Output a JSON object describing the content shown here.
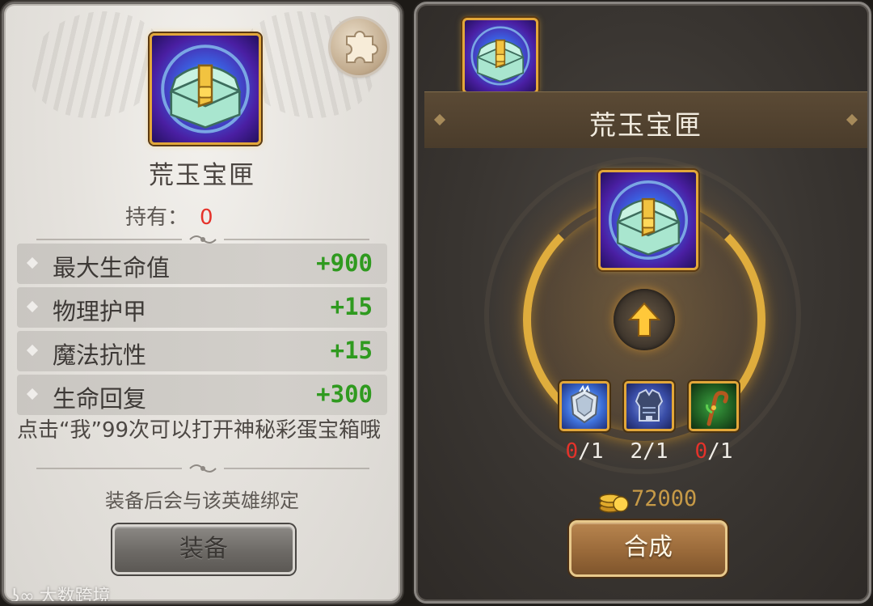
{
  "left_panel": {
    "item_name": "荒玉宝匣",
    "own_label": "持有：",
    "own_count": "0",
    "stats": [
      {
        "label": "最大生命值",
        "value": "+900"
      },
      {
        "label": "物理护甲",
        "value": "+15"
      },
      {
        "label": "魔法抗性",
        "value": "+15"
      },
      {
        "label": "生命回复",
        "value": "+300"
      }
    ],
    "description": "点击“我”99次可以打开神秘彩蛋宝箱哦",
    "bind_note": "装备后会与该英雄绑定",
    "equip_label": "装备"
  },
  "right_panel": {
    "title": "荒玉宝匣",
    "materials": [
      {
        "icon": "crystal-shield-icon",
        "have": "0",
        "need": "1"
      },
      {
        "icon": "armor-vest-icon",
        "have": "2",
        "need": "1"
      },
      {
        "icon": "cane-staff-icon",
        "have": "0",
        "need": "1"
      }
    ],
    "cost": "72000",
    "craft_label": "合成"
  },
  "watermark": "大数跨境",
  "colors": {
    "stat_value": "#2f9a1f",
    "insufficient": "#e5322a",
    "frame_gold": "#e2a73a",
    "gold_text": "#c79a47"
  }
}
